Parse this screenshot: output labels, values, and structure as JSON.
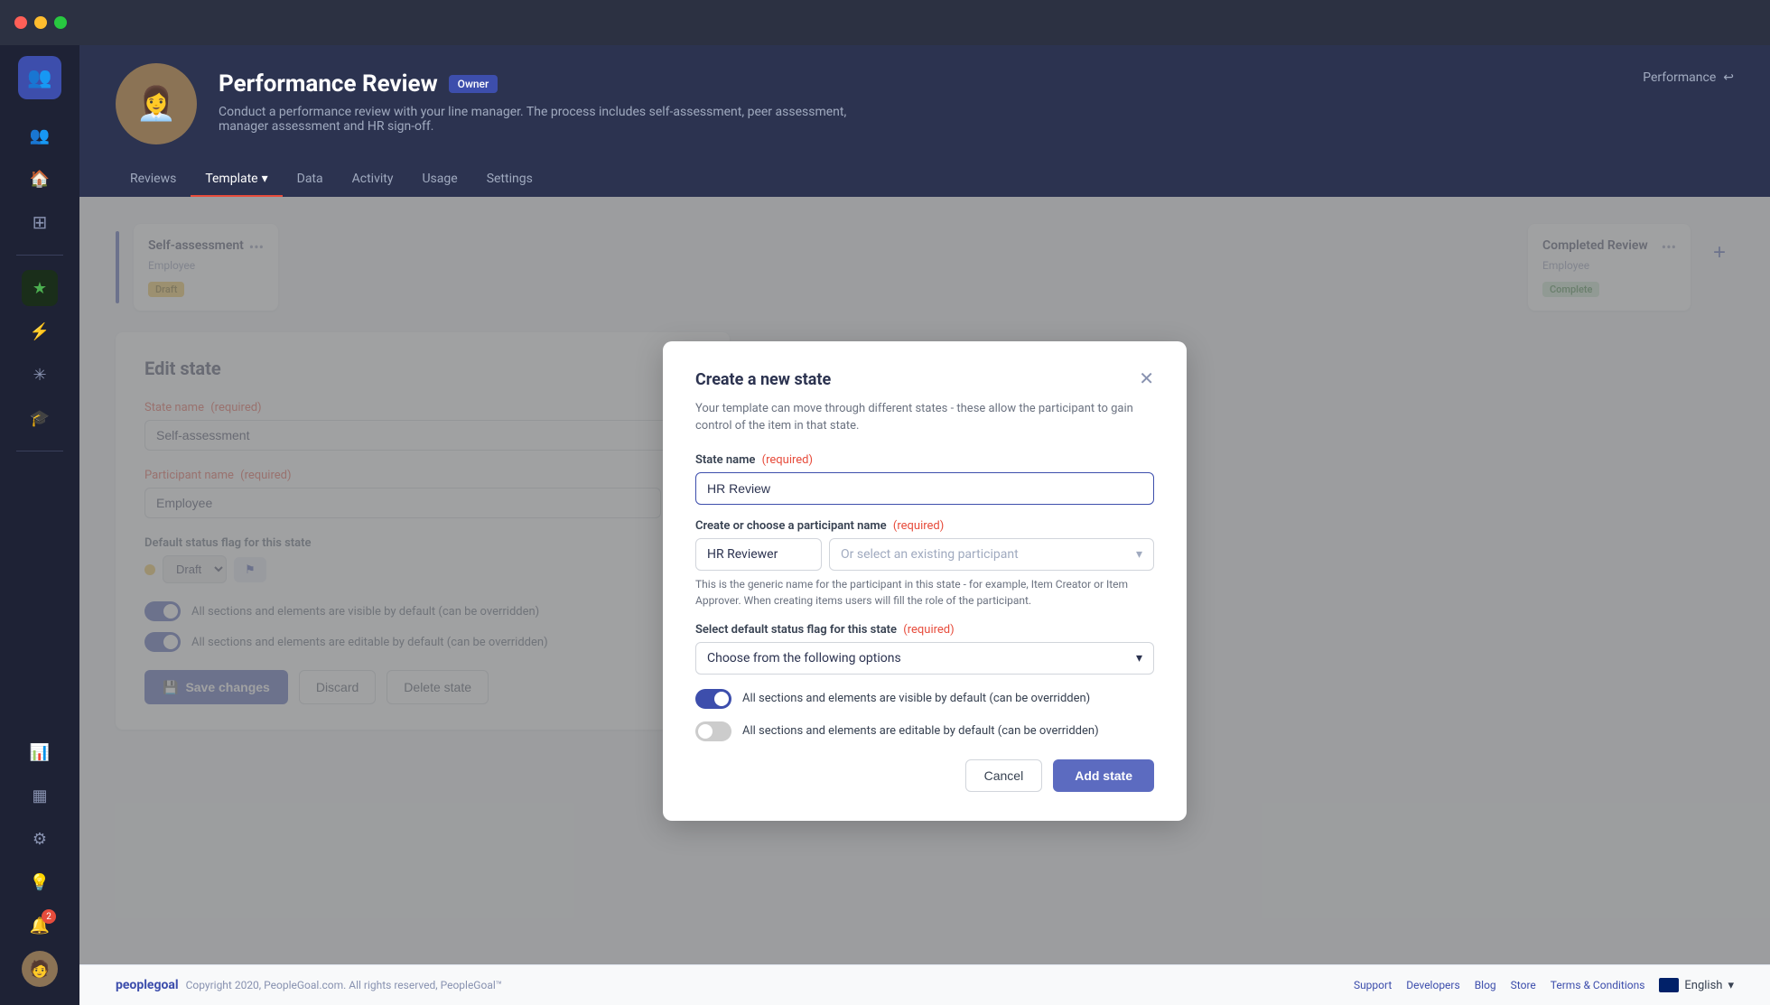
{
  "window": {
    "title": "Performance Review"
  },
  "header": {
    "title": "Performance Review",
    "owner_badge": "Owner",
    "description": "Conduct a performance review with your line manager. The process includes self-assessment, peer assessment, manager assessment and HR sign-off.",
    "breadcrumb": "Performance"
  },
  "nav": {
    "tabs": [
      {
        "label": "Reviews",
        "active": false
      },
      {
        "label": "Template",
        "active": true,
        "has_arrow": true
      },
      {
        "label": "Data",
        "active": false
      },
      {
        "label": "Activity",
        "active": false
      },
      {
        "label": "Usage",
        "active": false
      },
      {
        "label": "Settings",
        "active": false
      }
    ]
  },
  "states": [
    {
      "title": "Self-assessment",
      "sub": "Employee",
      "badge": "Draft",
      "badge_type": "draft"
    },
    {
      "title": "Completed Review",
      "sub": "Employee",
      "badge": "Complete",
      "badge_type": "complete"
    }
  ],
  "edit_state": {
    "title": "Edit state",
    "state_name_label": "State name",
    "state_name_required": "(required)",
    "state_name_value": "Self-assessment",
    "participant_label": "Participant name",
    "participant_required": "(required)",
    "participant_value": "Employee",
    "status_flag_label": "Default status flag for this state",
    "status_flag_value": "Draft",
    "toggle1_label": "All sections and elements are visible by default (can be overridden)",
    "toggle1_on": true,
    "toggle2_label": "All sections and elements are editable by default (can be overridden)",
    "toggle2_on": true,
    "save_btn": "Save changes"
  },
  "modal": {
    "title": "Create a new state",
    "description": "Your template can move through different states - these allow the participant to gain control of the item in that state.",
    "state_name_label": "State name",
    "state_name_required": "(required)",
    "state_name_value": "HR Review",
    "participant_label": "Create or choose a participant name",
    "participant_required": "(required)",
    "participant_value": "HR Reviewer",
    "participant_placeholder": "Or select an existing participant",
    "participant_hint": "This is the generic name for the participant in this state - for example, Item Creator or Item Approver. When creating items users will fill the role of the participant.",
    "status_label": "Select default status flag for this state",
    "status_required": "(required)",
    "status_placeholder": "Choose from the following options",
    "toggle1_label": "All sections and elements are visible by default (can be overridden)",
    "toggle1_on": true,
    "toggle2_label": "All sections and elements are editable by default (can be overridden)",
    "toggle2_on": false,
    "cancel_btn": "Cancel",
    "add_btn": "Add state"
  },
  "footer": {
    "logo": "peoplegoal",
    "copyright": "Copyright 2020, PeopleGoal.com. All rights reserved, PeopleGoal™",
    "links": [
      "Support",
      "Developers",
      "Blog",
      "Store",
      "Terms & Conditions"
    ],
    "language": "English"
  },
  "sidebar": {
    "icons": [
      {
        "name": "users-icon",
        "symbol": "👥",
        "active": true
      },
      {
        "name": "home-icon",
        "symbol": "🏠",
        "active": false
      },
      {
        "name": "grid-icon",
        "symbol": "⊞",
        "active": false
      },
      {
        "name": "star-icon",
        "symbol": "★",
        "active": false,
        "green": true
      },
      {
        "name": "bolt-icon",
        "symbol": "⚡",
        "active": false
      },
      {
        "name": "asterisk-icon",
        "symbol": "✳",
        "active": false
      },
      {
        "name": "graduation-icon",
        "symbol": "🎓",
        "active": false
      }
    ],
    "bottom_icons": [
      {
        "name": "chart-icon",
        "symbol": "📊"
      },
      {
        "name": "table-icon",
        "symbol": "▦"
      },
      {
        "name": "settings-icon",
        "symbol": "⚙"
      },
      {
        "name": "bulb-icon",
        "symbol": "💡"
      },
      {
        "name": "bell-icon",
        "symbol": "🔔",
        "badge": "2"
      }
    ]
  }
}
